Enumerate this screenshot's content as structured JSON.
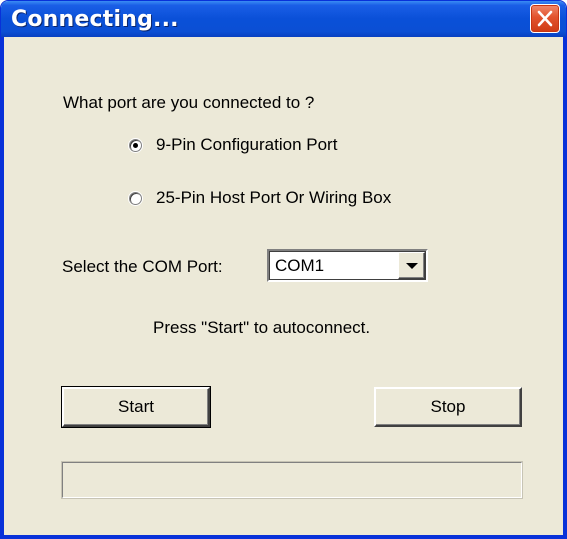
{
  "window": {
    "title": "Connecting...",
    "close_icon": "close-icon"
  },
  "port_question": "What port are you connected to ?",
  "port_options": [
    {
      "label": "9-Pin Configuration Port",
      "checked": true
    },
    {
      "label": "25-Pin Host Port Or Wiring Box",
      "checked": false
    }
  ],
  "com": {
    "label": "Select the COM Port:",
    "value": "COM1"
  },
  "hint": "Press \"Start\" to autoconnect.",
  "buttons": {
    "start": "Start",
    "stop": "Stop"
  },
  "progress": {
    "fraction": 0
  },
  "colors": {
    "title_bar": "#0a50d8",
    "close_button": "#e2532e",
    "dialog_bg": "#ece9d8"
  }
}
